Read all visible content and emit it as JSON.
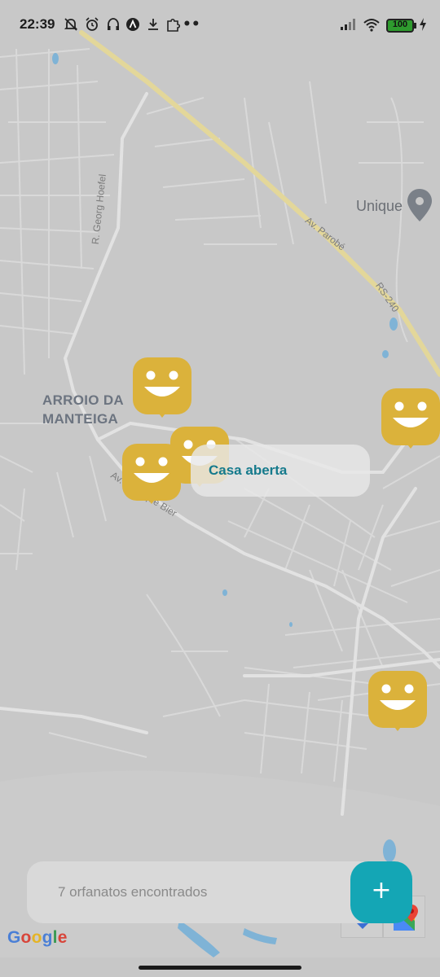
{
  "status_bar": {
    "time": "22:39",
    "icons": [
      "bell-muted-icon",
      "alarm-icon",
      "headphones-icon",
      "a-badge-icon",
      "download-icon",
      "puzzle-icon",
      "more-dots-icon",
      "signal-icon",
      "wifi-icon",
      "battery-icon",
      "charging-icon"
    ],
    "more": "••",
    "battery": "100"
  },
  "map": {
    "area_label_line1": "ARROIO DA",
    "area_label_line2": "MANTEIGA",
    "poi_label": "Unique",
    "road_labels": {
      "georg": "R. Georg Hoefel",
      "parobe": "Av. Parobé",
      "rs240": "RS-240",
      "bier": "Av. Henrique Bier"
    },
    "colors": {
      "background": "#c8c8c8",
      "road": "#e2e2e2",
      "highway": "#e3d79a",
      "water": "#7fb3d6",
      "marker": "#dbb23b"
    }
  },
  "popup": {
    "label": "Casa aberta"
  },
  "footer": {
    "text": "7 orfanatos encontrados",
    "add_label": "+"
  },
  "google_logo": [
    "G",
    "o",
    "o",
    "g",
    "l",
    "e"
  ],
  "accent_color": "#14a6b5"
}
